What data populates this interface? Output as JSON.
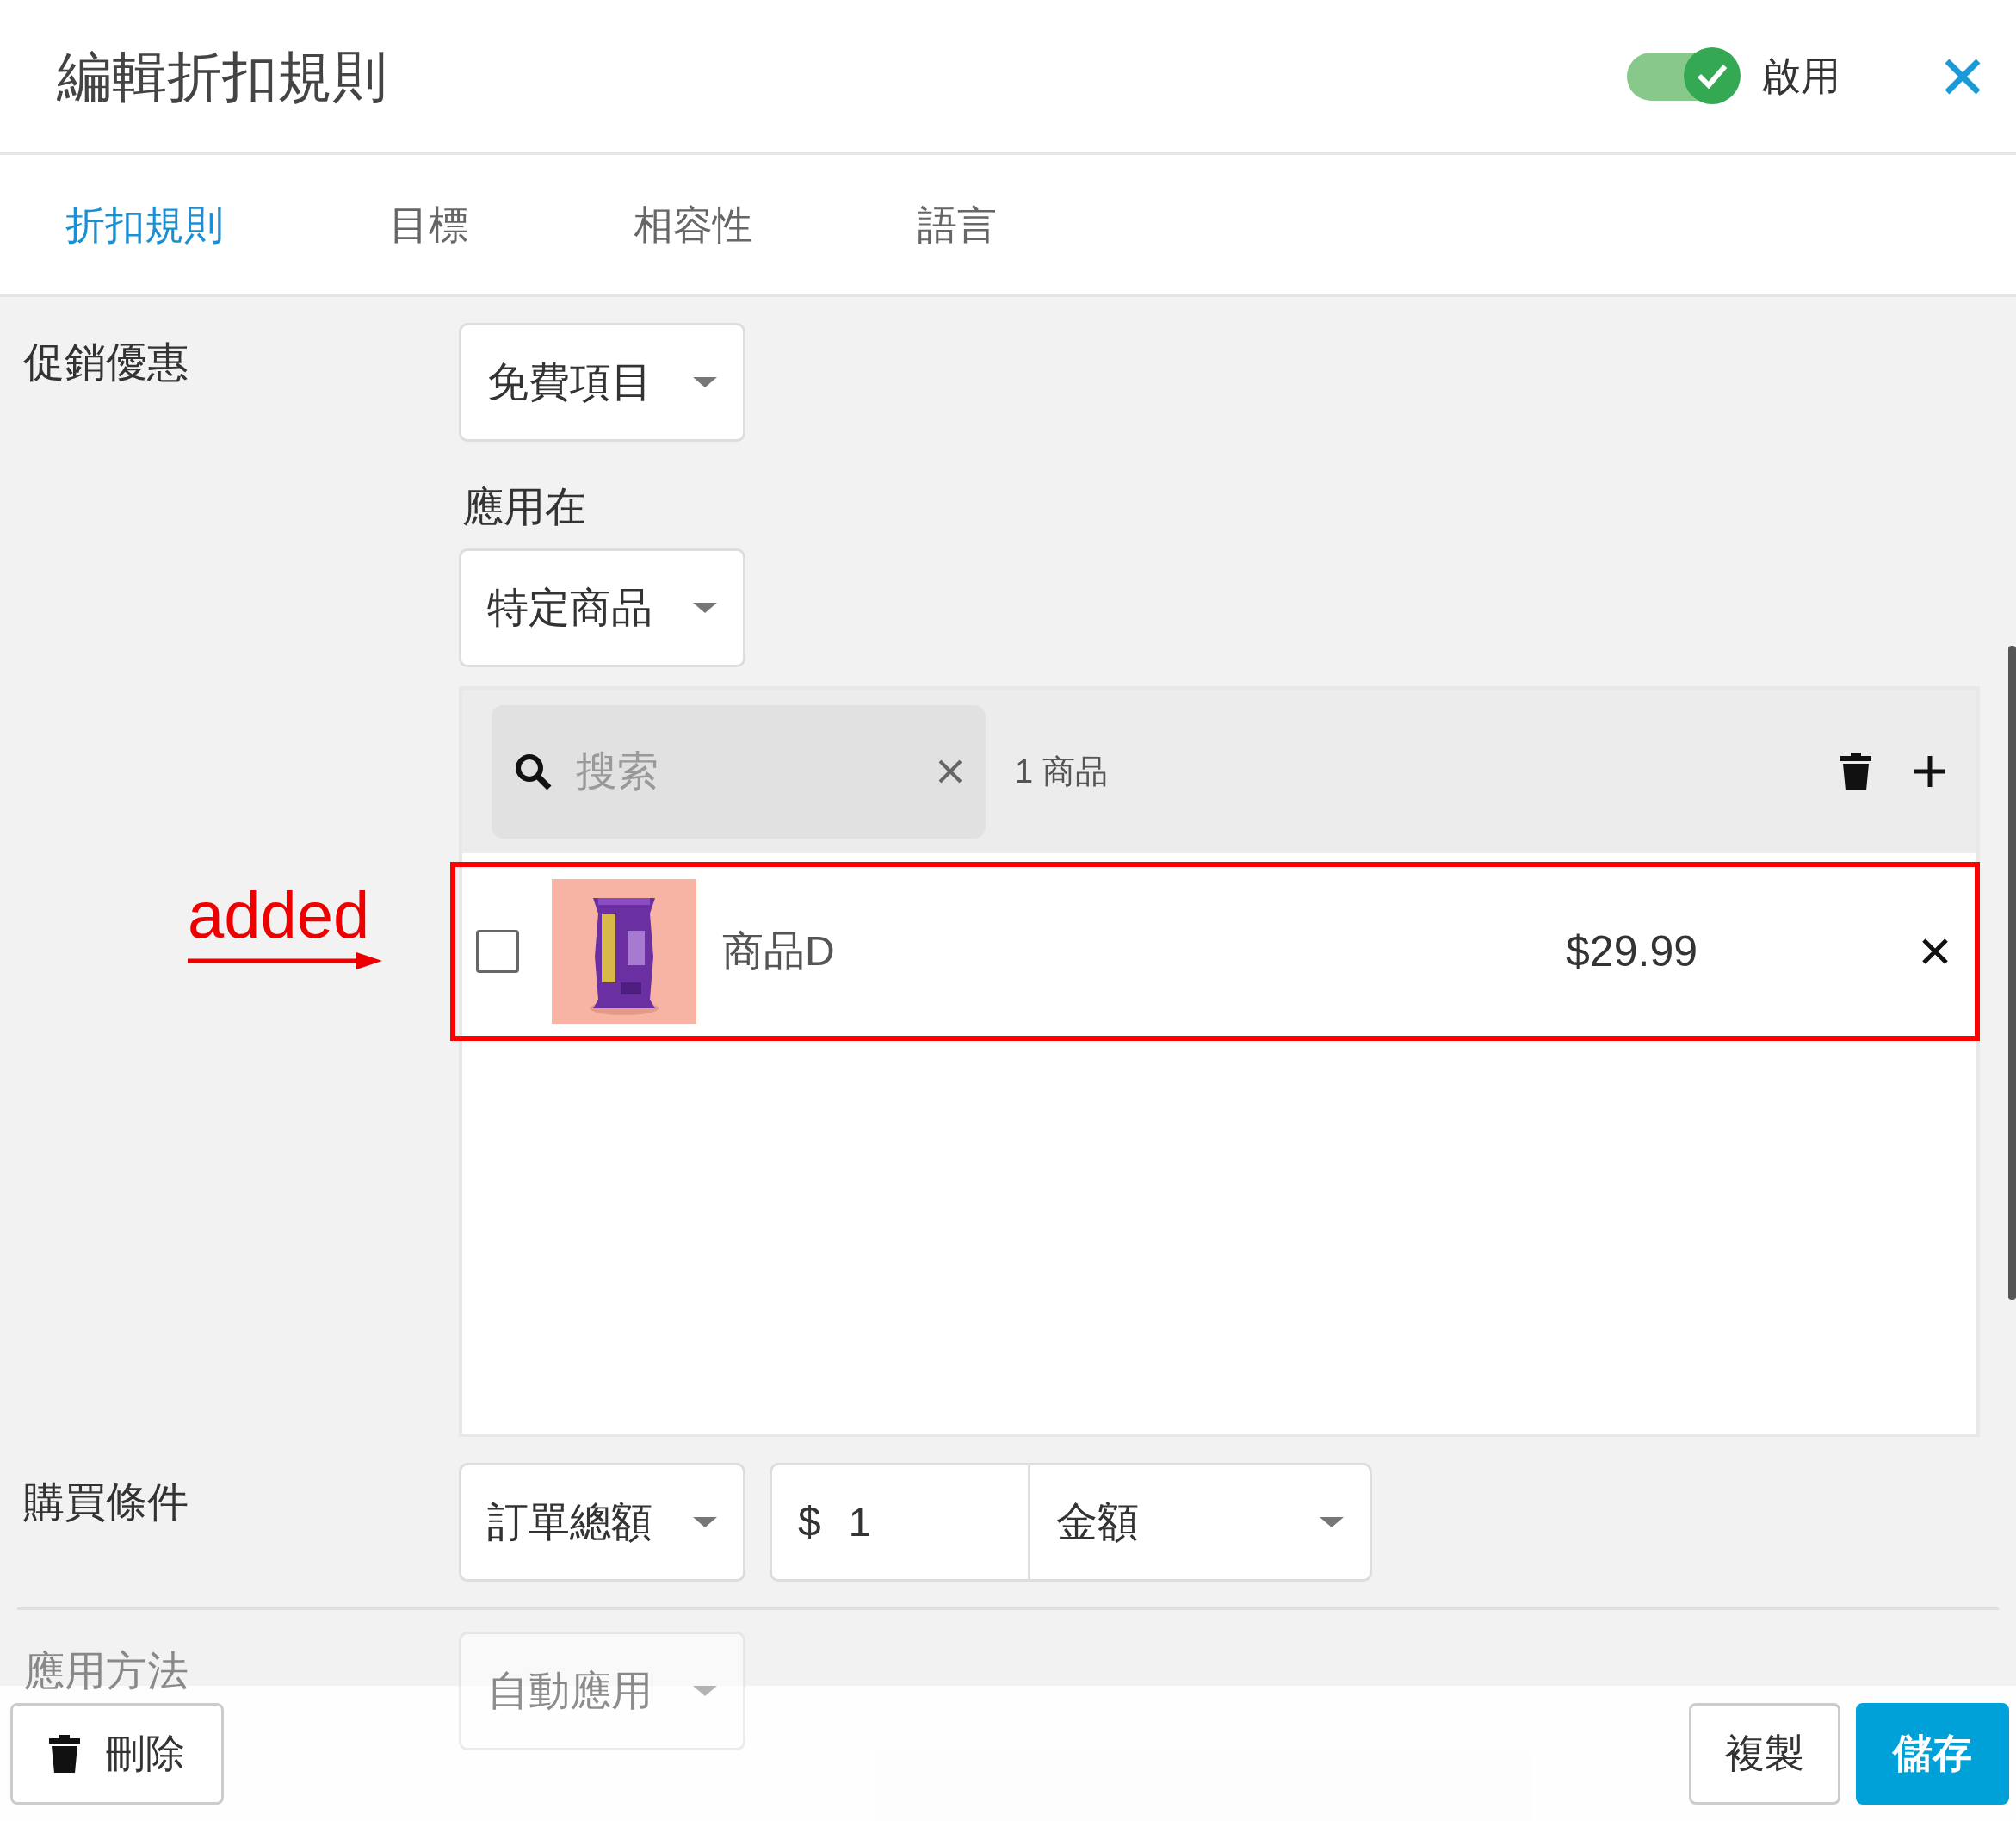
{
  "header": {
    "title": "編輯折扣規則",
    "toggle": {
      "label": "啟用",
      "on": true
    }
  },
  "tabs": [
    {
      "label": "折扣規則",
      "selected": true
    },
    {
      "label": "目標",
      "selected": false
    },
    {
      "label": "相容性",
      "selected": false
    },
    {
      "label": "語言",
      "selected": false
    }
  ],
  "promotion": {
    "label": "促銷優惠",
    "value": "免費項目"
  },
  "apply_to": {
    "label": "應用在",
    "value": "特定商品"
  },
  "products": {
    "search": {
      "placeholder": "搜索"
    },
    "count": "1 商品",
    "items": [
      {
        "name": "商品D",
        "price": "$29.99",
        "checked": false,
        "highlighted": true
      }
    ]
  },
  "annotation": {
    "text": "added"
  },
  "purchase_condition": {
    "label": "購買條件",
    "type": "訂單總額",
    "currency": "$",
    "amount": "1",
    "unit": "金額"
  },
  "apply_method": {
    "label": "應用方法",
    "value": "自動應用"
  },
  "footer": {
    "buttons": [
      {
        "label": "刪除",
        "kind": "delete"
      },
      {
        "label": "複製",
        "kind": "secondary"
      },
      {
        "label": "儲存",
        "kind": "primary"
      }
    ]
  }
}
